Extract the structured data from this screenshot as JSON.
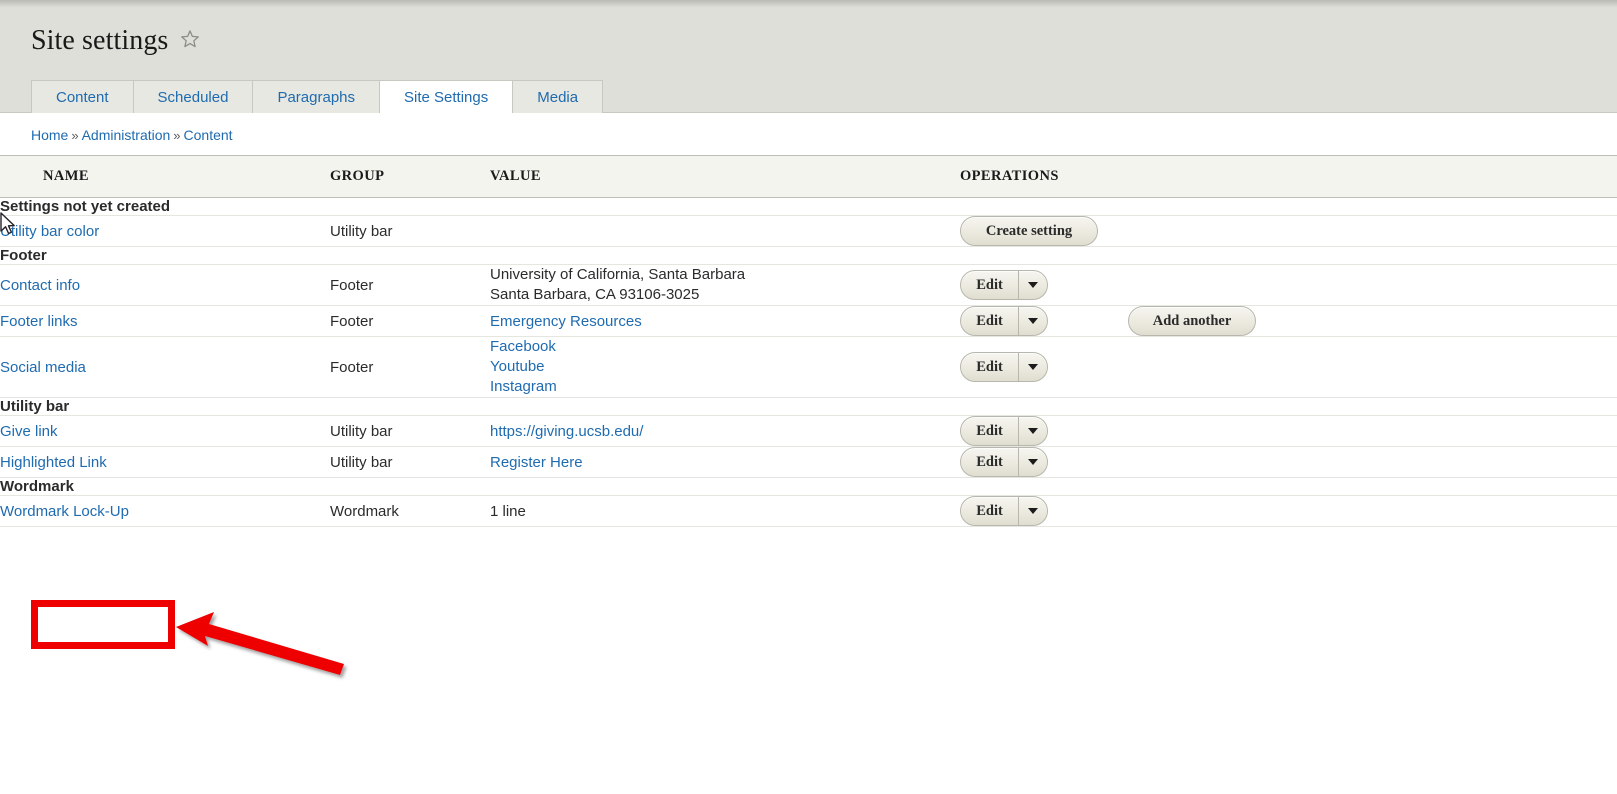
{
  "header": {
    "title": "Site settings",
    "star_icon": "star-outline-icon"
  },
  "tabs": [
    {
      "label": "Content",
      "active": false
    },
    {
      "label": "Scheduled",
      "active": false
    },
    {
      "label": "Paragraphs",
      "active": false
    },
    {
      "label": "Site Settings",
      "active": true
    },
    {
      "label": "Media",
      "active": false
    }
  ],
  "breadcrumb": {
    "items": [
      "Home",
      "Administration",
      "Content"
    ],
    "separator": "»"
  },
  "table": {
    "columns": [
      "NAME",
      "GROUP",
      "VALUE",
      "OPERATIONS"
    ],
    "sections": [
      {
        "group_label": "Settings not yet created",
        "rows": [
          {
            "name": "Utility bar color",
            "group": "Utility bar",
            "value_lines": [],
            "operations": {
              "type": "button",
              "label": "Create setting"
            }
          }
        ]
      },
      {
        "group_label": "Footer",
        "rows": [
          {
            "name": "Contact info",
            "group": "Footer",
            "value_lines": [
              {
                "text": "University of California, Santa Barbara",
                "link": false
              },
              {
                "text": "Santa Barbara, CA 93106-3025",
                "link": false
              }
            ],
            "operations": {
              "type": "dropbutton",
              "label": "Edit",
              "toggle_icon": "chevron-down-icon"
            }
          },
          {
            "name": "Footer links",
            "group": "Footer",
            "value_lines": [
              {
                "text": "Emergency Resources",
                "link": true
              }
            ],
            "operations": {
              "type": "dropbutton",
              "label": "Edit",
              "toggle_icon": "chevron-down-icon",
              "extra_label": "Add another"
            }
          },
          {
            "name": "Social media",
            "group": "Footer",
            "value_lines": [
              {
                "text": "Facebook",
                "link": true
              },
              {
                "text": "Youtube",
                "link": true
              },
              {
                "text": "Instagram",
                "link": true
              }
            ],
            "operations": {
              "type": "dropbutton",
              "label": "Edit",
              "toggle_icon": "chevron-down-icon"
            }
          }
        ]
      },
      {
        "group_label": "Utility bar",
        "rows": [
          {
            "name": "Give link",
            "group": "Utility bar",
            "value_lines": [
              {
                "text": "https://giving.ucsb.edu/",
                "link": true
              }
            ],
            "operations": {
              "type": "dropbutton",
              "label": "Edit",
              "toggle_icon": "chevron-down-icon"
            }
          },
          {
            "name": "Highlighted Link",
            "group": "Utility bar",
            "value_lines": [
              {
                "text": "Register Here",
                "link": true
              }
            ],
            "operations": {
              "type": "dropbutton",
              "label": "Edit",
              "toggle_icon": "chevron-down-icon"
            },
            "highlighted": true
          }
        ]
      },
      {
        "group_label": "Wordmark",
        "rows": [
          {
            "name": "Wordmark Lock-Up",
            "group": "Wordmark",
            "value_lines": [
              {
                "text": "1 line",
                "link": false
              }
            ],
            "operations": {
              "type": "dropbutton",
              "label": "Edit",
              "toggle_icon": "chevron-down-icon"
            }
          }
        ]
      }
    ]
  },
  "annotation": {
    "highlight_color": "#ee0000",
    "arrow_color": "#ee0000",
    "target": "Highlighted Link"
  },
  "colors": {
    "link": "#1f6bb0",
    "header_bg": "#dedfd8",
    "thead_bg": "#f4f4ef",
    "accent_red": "#ee0000"
  }
}
